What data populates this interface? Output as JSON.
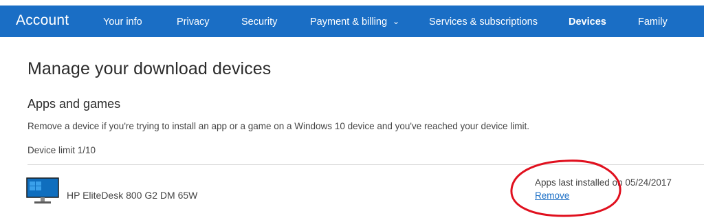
{
  "nav": {
    "brand": "Account",
    "items": [
      {
        "label": "Your info"
      },
      {
        "label": "Privacy"
      },
      {
        "label": "Security"
      },
      {
        "label": "Payment & billing"
      },
      {
        "label": "Services & subscriptions"
      },
      {
        "label": "Devices"
      },
      {
        "label": "Family"
      }
    ],
    "active": "Devices",
    "background": "#1a6ec5"
  },
  "page": {
    "title": "Manage your download devices"
  },
  "apps_section": {
    "title": "Apps and games",
    "description": "Remove a device if you're trying to install an app or a game on a Windows 10 device and you've reached your device limit.",
    "limit_text": "Device limit 1/10"
  },
  "device": {
    "icon": "desktop-monitor-icon",
    "name": "HP EliteDesk 800 G2 DM 65W",
    "install_text": "Apps last installed on 05/24/2017",
    "remove_label": "Remove"
  },
  "annotation": {
    "color": "#e0101e"
  }
}
